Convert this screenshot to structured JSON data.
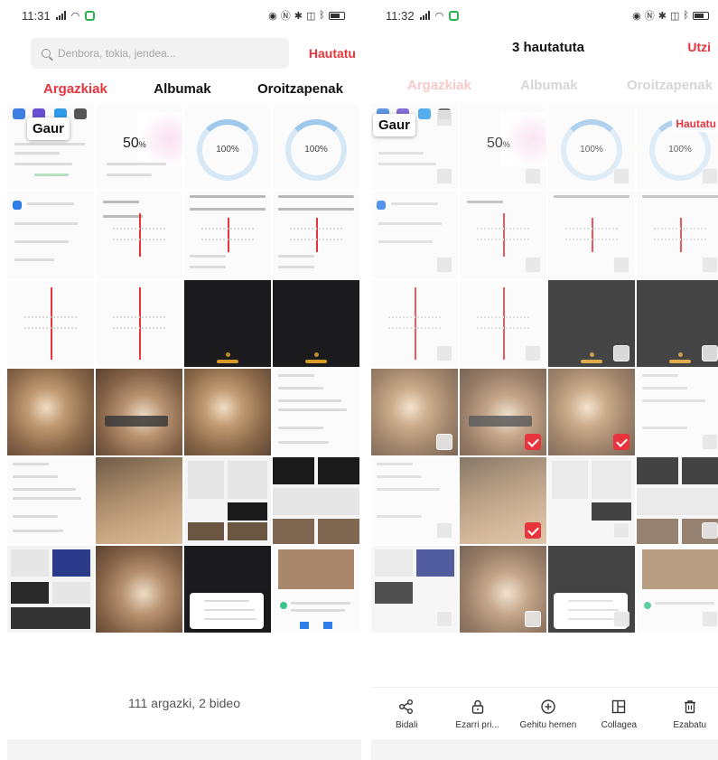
{
  "left": {
    "status": {
      "time": "11:31"
    },
    "search": {
      "placeholder": "Denbora, tokia, jendea..."
    },
    "cancel_label": "Hautatu",
    "tabs": [
      {
        "label": "Argazkiak",
        "active": true
      },
      {
        "label": "Albumak",
        "active": false
      },
      {
        "label": "Oroitzapenak",
        "active": false
      }
    ],
    "date_chip": "Gaur",
    "thumb_text": {
      "percent": "50",
      "percent_unit": "%",
      "ring_value": "100%"
    },
    "summary": "111 argazki, 2 bideo"
  },
  "right": {
    "status": {
      "time": "11:32"
    },
    "title": "3 hautatuta",
    "cancel_label": "Utzi",
    "tabs": [
      {
        "label": "Argazkiak",
        "active": true
      },
      {
        "label": "Albumak",
        "active": false
      },
      {
        "label": "Oroitzapenak",
        "active": false
      }
    ],
    "date_chip": "Gaur",
    "select_label": "Hautatu",
    "thumb_text": {
      "percent": "50",
      "percent_unit": "%",
      "ring_value": "100%"
    },
    "selected_count": 3,
    "actions": [
      {
        "label": "Bidali",
        "icon": "share-icon"
      },
      {
        "label": "Ezarri pri...",
        "icon": "lock-icon"
      },
      {
        "label": "Gehitu hemen",
        "icon": "add-circle-icon"
      },
      {
        "label": "Collagea",
        "icon": "collage-icon"
      },
      {
        "label": "Ezabatu",
        "icon": "trash-icon"
      }
    ]
  },
  "colors": {
    "accent": "#e8343d",
    "muted_tab": "#d6d6d6",
    "text": "#222222"
  }
}
